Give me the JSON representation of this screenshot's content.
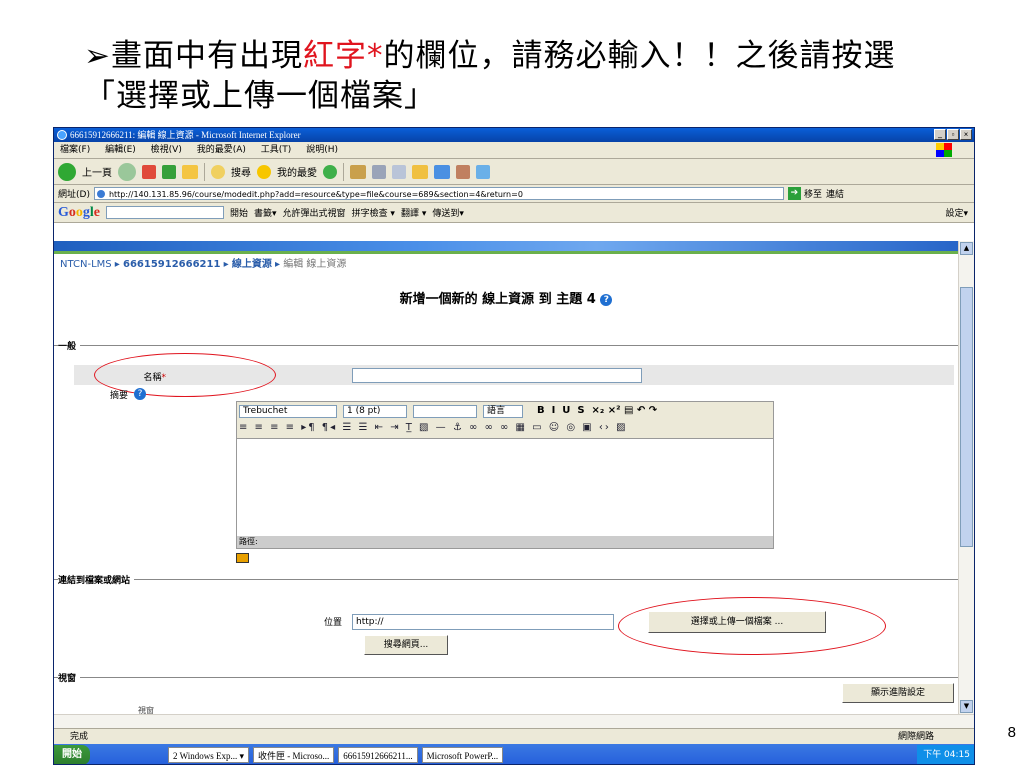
{
  "slide": {
    "title_prefix": "➢畫面中有出現",
    "title_red": "紅字*",
    "title_mid": "的欄位，請務必輸入！！之後請按選",
    "title_line2": "「選擇或上傳一個檔案」",
    "page_number": "8",
    "accent_red": "#e0141e"
  },
  "window": {
    "title": "66615912666211: 編輯 線上資源 - Microsoft Internet Explorer",
    "menu": [
      "檔案(F)",
      "編輯(E)",
      "檢視(V)",
      "我的最愛(A)",
      "工具(T)",
      "說明(H)"
    ],
    "toolbar": {
      "back": "上一頁",
      "search": "搜尋",
      "favorites": "我的最愛"
    },
    "address_label": "網址(D)",
    "address": "http://140.131.85.96/course/modedit.php?add=resource&type=file&course=689&section=4&return=0",
    "go": "移至",
    "links": "連結",
    "google": {
      "logo": [
        "G",
        "o",
        "o",
        "g",
        "l",
        "e"
      ],
      "start": "開始",
      "bookmarks": "書籤▾",
      "popups": "允許彈出式視窗",
      "spell": "拼字檢查 ▾",
      "translate": "翻譯 ▾",
      "send": "傳送到▾",
      "settings": "設定▾"
    }
  },
  "page": {
    "breadcrumb": {
      "site": "NTCN-LMS",
      "course": "66615912666211",
      "section": "線上資源",
      "current": "編輯 線上資源"
    },
    "heading": "新增一個新的 線上資源 到 主題 4",
    "general_legend": "一般",
    "name_label": "名稱",
    "name_required": "*",
    "summary_label": "摘要",
    "editor": {
      "font": "Trebuchet",
      "size": "1 (8 pt)",
      "lang": "語言",
      "path_label": "路徑:"
    },
    "link_legend": "連結到檔案或網站",
    "location_label": "位置",
    "location_value": "http://",
    "choose_button": "選擇或上傳一個檔案 ...",
    "search_web_button": "搜尋網頁...",
    "window_legend": "視窗",
    "advanced_button": "顯示進階設定",
    "window_label": "視窗"
  },
  "status": {
    "left": "完成",
    "right": "網際網路"
  },
  "taskbar": {
    "start": "開始",
    "items": [
      "2 Windows Exp... ▾",
      "收件匣 - Microso...",
      "66615912666211...",
      "Microsoft PowerP..."
    ],
    "clock": "下午 04:15"
  }
}
